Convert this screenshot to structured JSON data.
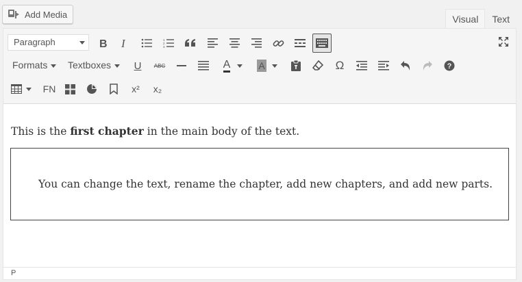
{
  "media": {
    "add_label": "Add Media"
  },
  "tabs": [
    {
      "label": "Visual",
      "active": true
    },
    {
      "label": "Text",
      "active": false
    }
  ],
  "toolbar": {
    "format_select": "Paragraph",
    "formats_label": "Formats",
    "textboxes_label": "Textboxes",
    "fn_label": "FN",
    "sup_label": "x²",
    "sub_label": "x₂",
    "special_char": "Ω",
    "strikethrough_text": "ABC",
    "underline_text": "U",
    "text_color_letter": "A",
    "bg_color_letter": "A"
  },
  "content": {
    "para_before": "This is the ",
    "para_bold": "first chapter",
    "para_after": " in the main body of the text.",
    "box_text": "You can change the text, rename the chapter, add new chapters, and add new parts."
  },
  "status": {
    "path": "P"
  },
  "colors": {
    "accent": "#555555",
    "toolbar_bg": "#f5f5f5",
    "border": "#e5e5e5"
  }
}
